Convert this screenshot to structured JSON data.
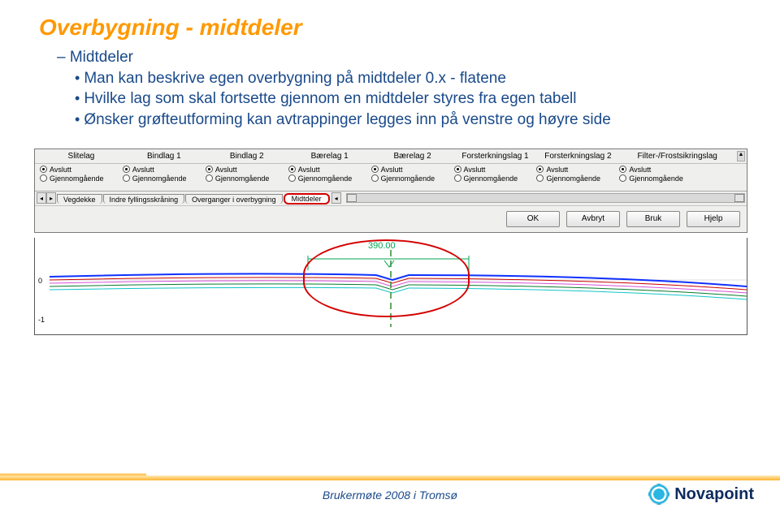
{
  "title": "Overbygning  - midtdeler",
  "intro_dash": "– ",
  "intro": "Midtdeler",
  "bullets": [
    "Man kan beskrive egen overbygning på midtdeler 0.x - flatene",
    "Hvilke lag som skal fortsette gjennom en midtdeler styres fra egen tabell",
    "Ønsker grøfteutforming kan avtrappinger legges inn på venstre og høyre side"
  ],
  "columns": [
    "Slitelag",
    "Bindlag 1",
    "Bindlag 2",
    "Bærelag 1",
    "Bærelag 2",
    "Forsterkningslag 1",
    "Forsterkningslag 2",
    "Filter-/Frostsikringslag"
  ],
  "radio": {
    "opt1": "Avslutt",
    "opt2": "Gjennomgående"
  },
  "tabs": {
    "t1": "Vegdekke",
    "t2": "Indre fyllingsskråning",
    "t3": "Overganger i overbygning",
    "t4": "Midtdeler"
  },
  "buttons": {
    "ok": "OK",
    "cancel": "Avbryt",
    "apply": "Bruk",
    "help": "Hjelp"
  },
  "profile": {
    "y0": "0",
    "ym1": "-1",
    "measure": "390.00"
  },
  "footer": "Brukermøte 2008 i Tromsø",
  "logo": "Novapoint"
}
